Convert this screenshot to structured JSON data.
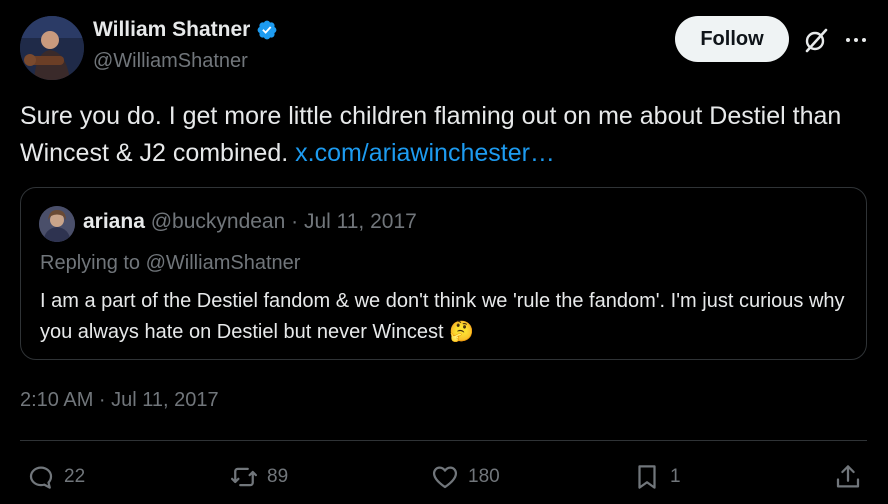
{
  "author": {
    "display_name": "William Shatner",
    "handle": "@WilliamShatner"
  },
  "header": {
    "follow_label": "Follow",
    "grok_icon": "grok-icon",
    "more_icon": "more-dots-icon"
  },
  "tweet": {
    "text": "Sure you do. I get more little children flaming out on me about Destiel than Wincest & J2 combined. ",
    "link_text": "x.com/ariawinchester…",
    "timestamp": "2:10 AM · Jul 11, 2017"
  },
  "quote": {
    "name": "ariana",
    "meta": "@buckyndean · Jul 11, 2017",
    "reply_to": "Replying to @WilliamShatner",
    "text": "I am a part of the Destiel fandom & we don't think we 'rule the fandom'. I'm just curious why you always hate on Destiel but never Wincest ",
    "emoji": "🤔"
  },
  "actions": {
    "replies": "22",
    "reposts": "89",
    "likes": "180",
    "bookmarks": "1"
  },
  "colors": {
    "background": "#000000",
    "text": "#e7e9ea",
    "muted": "#71767b",
    "link": "#1d9bf0",
    "border": "#2f3336",
    "verified": "#1d9bf0"
  }
}
